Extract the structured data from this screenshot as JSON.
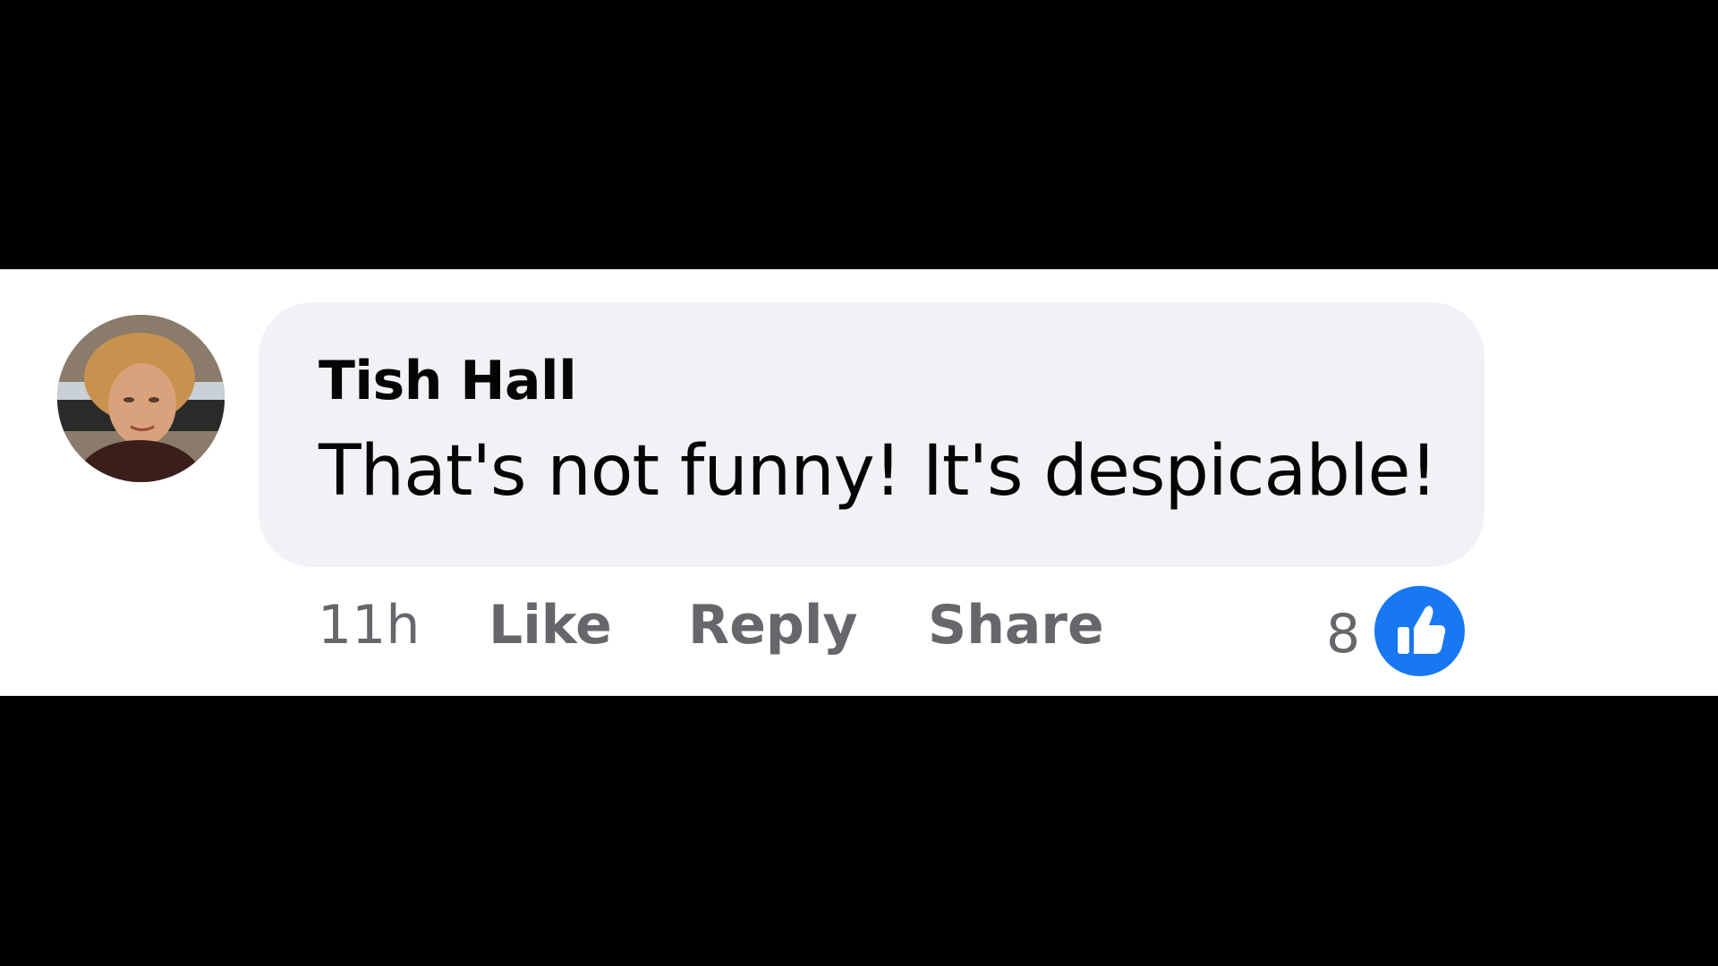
{
  "comment": {
    "author": "Tish Hall",
    "text": "That's not funny! It's despicable!",
    "timestamp": "11h",
    "actions": {
      "like_label": "Like",
      "reply_label": "Reply",
      "share_label": "Share"
    },
    "reactions": {
      "count": "8",
      "icon": "thumbs-up-icon",
      "color": "#1877f2"
    },
    "bubble_color": "#f0f2f5"
  }
}
